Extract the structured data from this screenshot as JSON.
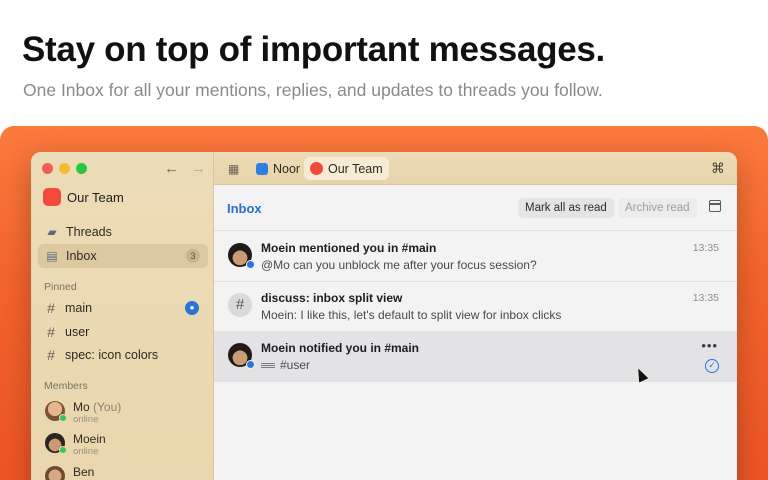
{
  "hero": {
    "headline": "Stay on top of important messages.",
    "subline": "One Inbox for all your mentions, replies, and updates to threads you follow."
  },
  "colors": {
    "backdrop": "#f4632d",
    "accent": "#2d73d9",
    "sidebar": "#ecdcb7",
    "team_badge": "#f24a3d",
    "online": "#35c759"
  },
  "sidebar": {
    "team_name": "Our Team",
    "nav": [
      {
        "label": "Threads",
        "icon": "threads-icon"
      },
      {
        "label": "Inbox",
        "icon": "inbox-icon",
        "count": "3"
      }
    ],
    "pinned_label": "Pinned",
    "pinned": [
      {
        "label": "main",
        "icon": "hash-icon",
        "badge_icon": "bell-icon"
      },
      {
        "label": "user",
        "icon": "hash-icon"
      },
      {
        "label": "spec: icon colors",
        "icon": "hash-icon"
      }
    ],
    "members_label": "Members",
    "members": [
      {
        "name": "Mo",
        "suffix": "(You)",
        "status": "online"
      },
      {
        "name": "Moein",
        "status": "online"
      },
      {
        "name": "Ben"
      }
    ]
  },
  "tabs": [
    {
      "label": "Noor",
      "icon": "app-icon"
    },
    {
      "label": "Our Team",
      "icon": "team-icon"
    }
  ],
  "toolbar": {
    "title": "Inbox",
    "mark_all_read": "Mark all as read",
    "archive_read": "Archive read"
  },
  "messages": [
    {
      "title": "Moein mentioned you in #main",
      "body": "@Mo can you unblock me after your focus session?",
      "time": "13:35"
    },
    {
      "title": "discuss: inbox split view",
      "body": "Moein: I like this, let's default to split view for inbox clicks",
      "time": "13:35"
    },
    {
      "title": "Moein notified you in #main",
      "body": "#user"
    }
  ]
}
